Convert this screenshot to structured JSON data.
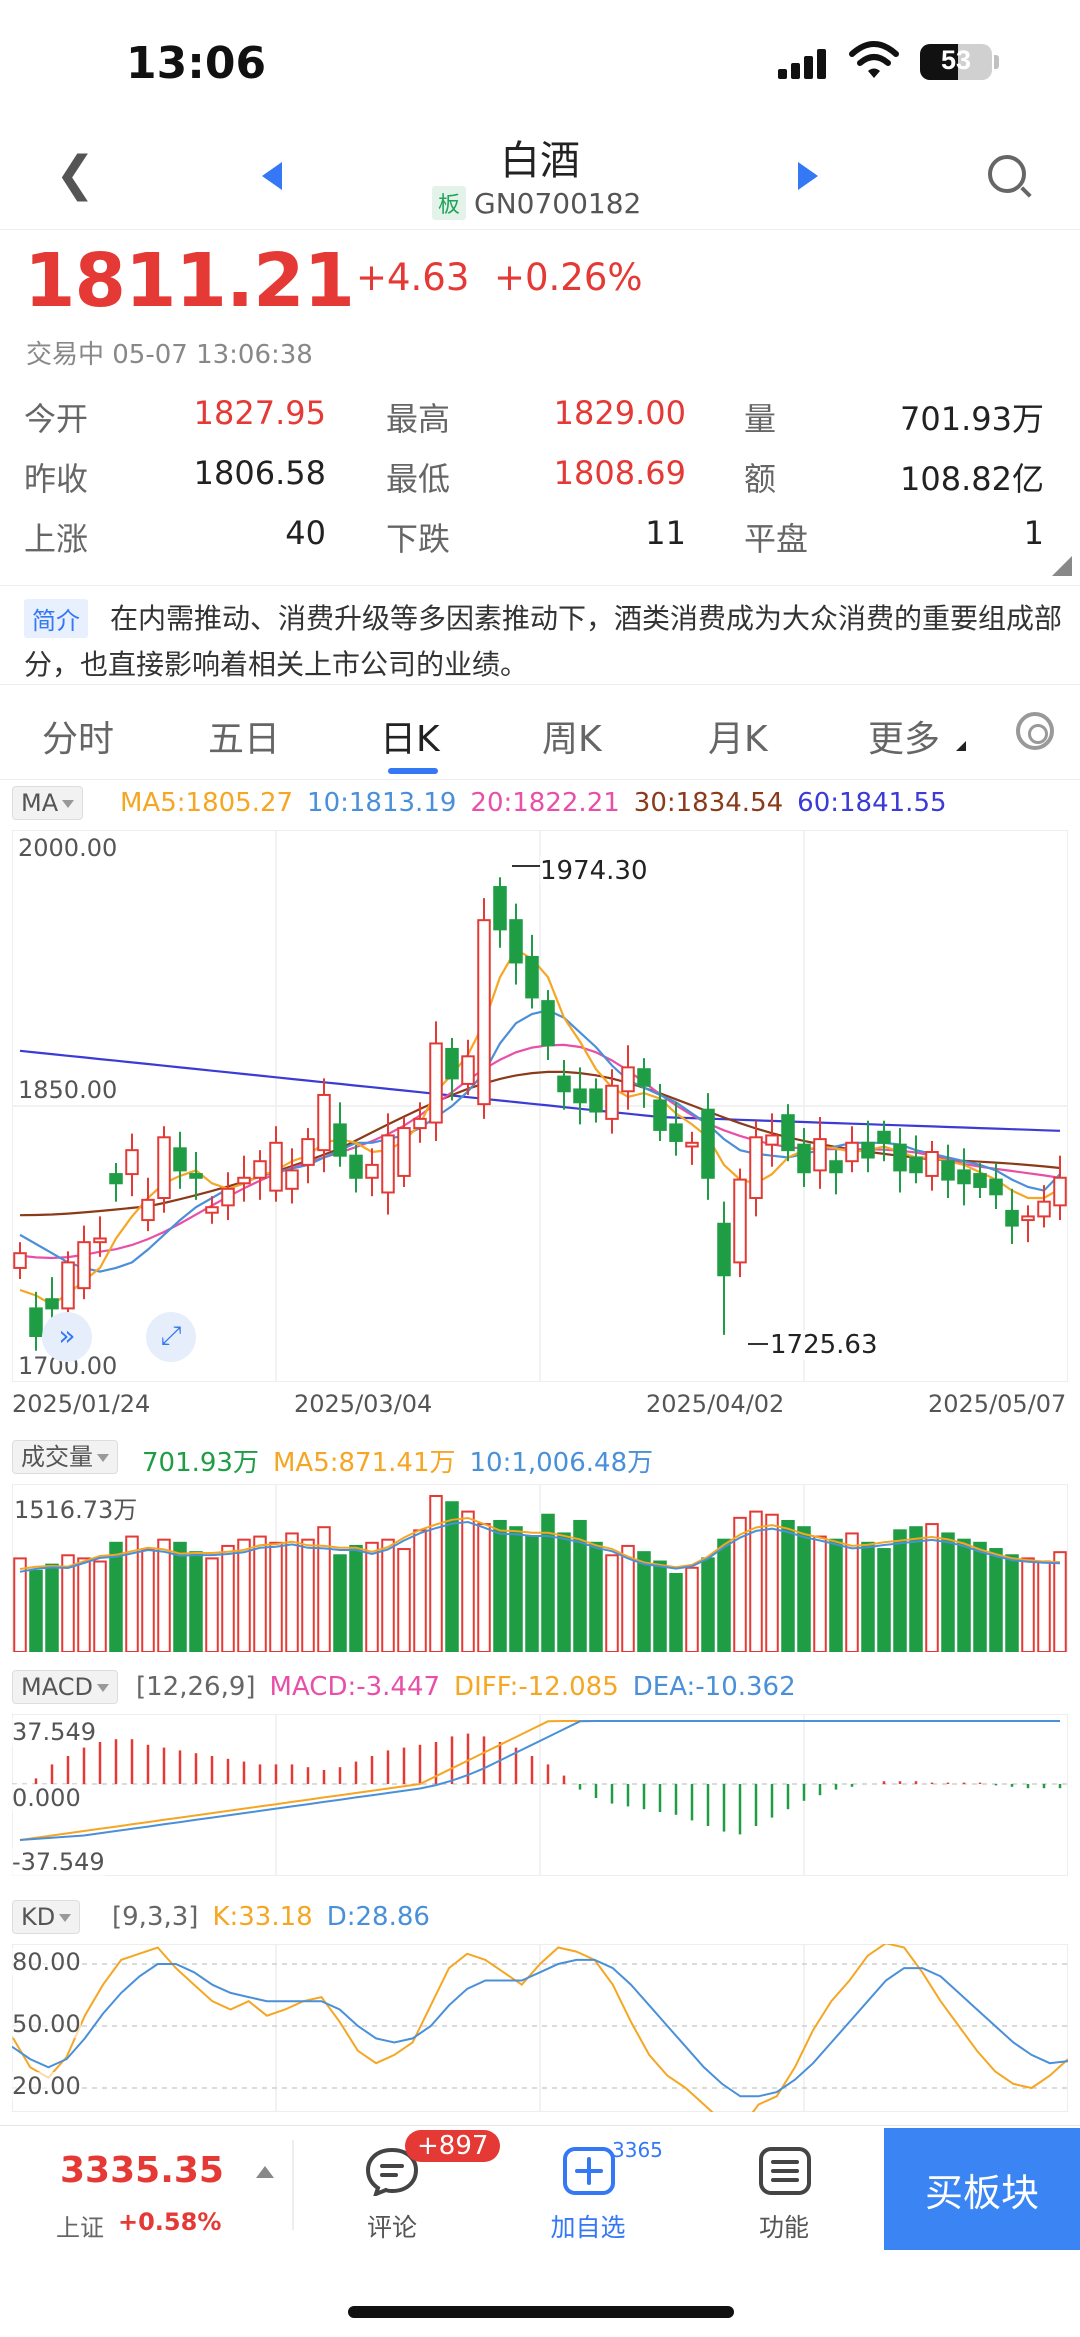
{
  "status_bar": {
    "time": "13:06",
    "battery": "53",
    "battery_fraction": 0.53
  },
  "nav": {
    "title": "白酒",
    "badge": "板",
    "code": "GN0700182"
  },
  "quote": {
    "price": "1811.21",
    "change": "+4.63",
    "change_pct": "+0.26%",
    "status": "交易中 05-07 13:06:38",
    "stats": [
      {
        "label": "今开",
        "value": "1827.95",
        "color": "red"
      },
      {
        "label": "最高",
        "value": "1829.00",
        "color": "red"
      },
      {
        "label": "量",
        "value": "701.93万",
        "color": "dark"
      },
      {
        "label": "昨收",
        "value": "1806.58",
        "color": "dark"
      },
      {
        "label": "最低",
        "value": "1808.69",
        "color": "red"
      },
      {
        "label": "额",
        "value": "108.82亿",
        "color": "dark"
      },
      {
        "label": "上涨",
        "value": "40",
        "color": "dark"
      },
      {
        "label": "下跌",
        "value": "11",
        "color": "dark"
      },
      {
        "label": "平盘",
        "value": "1",
        "color": "dark"
      }
    ]
  },
  "intro": {
    "tag": "简介",
    "text": "在内需推动、消费升级等多因素推动下，酒类消费成为大众消费的重要组成部分，也直接影响着相关上市公司的业绩。"
  },
  "tabs": [
    "分时",
    "五日",
    "日K",
    "周K",
    "月K",
    "更多"
  ],
  "active_tab": "日K",
  "colors": {
    "up": "#e53935",
    "down": "#1f9d45",
    "ma5": "#f5a623",
    "ma10": "#4a90d9",
    "ma20": "#e84fa8",
    "ma30": "#8b3a1a",
    "ma60": "#3b3bd6",
    "accent": "#3478f6"
  },
  "ma_bar": {
    "label": "MA",
    "ma5": "MA5:1805.27",
    "ma10": "10:1813.19",
    "ma20": "20:1822.21",
    "ma30": "30:1834.54",
    "ma60": "60:1841.55"
  },
  "kline_axis": {
    "top": "2000.00",
    "mid": "1850.00",
    "bottom": "1700.00",
    "high_label": "1974.30",
    "low_label": "1725.63"
  },
  "dates": [
    "2025/01/24",
    "2025/03/04",
    "2025/04/02",
    "2025/05/07"
  ],
  "volume_bar": {
    "label": "成交量",
    "vol": "701.93万",
    "ma5": "MA5:871.41万",
    "ma10": "10:1,006.48万",
    "axis_top": "1516.73万"
  },
  "macd_bar": {
    "label": "MACD",
    "params": "[12,26,9]",
    "macd": "MACD:-3.447",
    "diff": "DIFF:-12.085",
    "dea": "DEA:-10.362",
    "axis_top": "37.549",
    "axis_mid": "0.000",
    "axis_bottom": "-37.549"
  },
  "kd_bar": {
    "label": "KD",
    "params": "[9,3,3]",
    "k": "K:33.18",
    "d": "D:28.86",
    "axis_top": "80.00",
    "axis_mid": "50.00",
    "axis_bottom": "20.00"
  },
  "bottom": {
    "index_price": "3335.35",
    "index_name": "上证",
    "index_pct": "+0.58%",
    "comment_badge": "+897",
    "comment_label": "评论",
    "fav_count": "3365",
    "fav_label": "加自选",
    "func_label": "功能",
    "buy_label": "买板块"
  },
  "chart_data": {
    "type": "candlestick",
    "x_range": [
      "2025/01/24",
      "2025/05/07"
    ],
    "ylim": [
      1700,
      2000
    ],
    "candles": [
      {
        "o": 1762,
        "c": 1770
      },
      {
        "o": 1740,
        "c": 1725
      },
      {
        "o": 1745,
        "c": 1740
      },
      {
        "o": 1740,
        "c": 1765
      },
      {
        "o": 1751,
        "c": 1776
      },
      {
        "o": 1776,
        "c": 1778
      },
      {
        "o": 1813,
        "c": 1808
      },
      {
        "o": 1813,
        "c": 1826
      },
      {
        "o": 1788,
        "c": 1799
      },
      {
        "o": 1800,
        "c": 1833
      },
      {
        "o": 1827,
        "c": 1815
      },
      {
        "o": 1813,
        "c": 1811
      },
      {
        "o": 1792,
        "c": 1795
      },
      {
        "o": 1796,
        "c": 1805
      },
      {
        "o": 1808,
        "c": 1811
      },
      {
        "o": 1811,
        "c": 1820
      },
      {
        "o": 1804,
        "c": 1830
      },
      {
        "o": 1805,
        "c": 1815
      },
      {
        "o": 1818,
        "c": 1832
      },
      {
        "o": 1826,
        "c": 1856
      },
      {
        "o": 1840,
        "c": 1823
      },
      {
        "o": 1823,
        "c": 1811
      },
      {
        "o": 1811,
        "c": 1818
      },
      {
        "o": 1803,
        "c": 1834
      },
      {
        "o": 1812,
        "c": 1838
      },
      {
        "o": 1838,
        "c": 1843
      },
      {
        "o": 1841,
        "c": 1884
      },
      {
        "o": 1881,
        "c": 1865
      },
      {
        "o": 1862,
        "c": 1877
      },
      {
        "o": 1851,
        "c": 1951
      },
      {
        "o": 1969,
        "c": 1946
      },
      {
        "o": 1951,
        "c": 1928
      },
      {
        "o": 1931,
        "c": 1909
      },
      {
        "o": 1907,
        "c": 1883
      },
      {
        "o": 1866,
        "c": 1858
      },
      {
        "o": 1859,
        "c": 1852
      },
      {
        "o": 1859,
        "c": 1847
      },
      {
        "o": 1843,
        "c": 1861
      },
      {
        "o": 1858,
        "c": 1871
      },
      {
        "o": 1870,
        "c": 1861
      },
      {
        "o": 1853,
        "c": 1837
      },
      {
        "o": 1840,
        "c": 1831
      },
      {
        "o": 1828,
        "c": 1830
      },
      {
        "o": 1848,
        "c": 1811
      },
      {
        "o": 1786,
        "c": 1758
      },
      {
        "o": 1765,
        "c": 1810
      },
      {
        "o": 1800,
        "c": 1833
      },
      {
        "o": 1829,
        "c": 1834
      },
      {
        "o": 1845,
        "c": 1826
      },
      {
        "o": 1829,
        "c": 1814
      },
      {
        "o": 1815,
        "c": 1832
      },
      {
        "o": 1820,
        "c": 1814
      },
      {
        "o": 1820,
        "c": 1830
      },
      {
        "o": 1830,
        "c": 1822
      },
      {
        "o": 1836,
        "c": 1830
      },
      {
        "o": 1829,
        "c": 1815
      },
      {
        "o": 1822,
        "c": 1814
      },
      {
        "o": 1812,
        "c": 1825
      },
      {
        "o": 1820,
        "c": 1810
      },
      {
        "o": 1815,
        "c": 1808
      },
      {
        "o": 1813,
        "c": 1806
      },
      {
        "o": 1810,
        "c": 1802
      },
      {
        "o": 1793,
        "c": 1785
      },
      {
        "o": 1788,
        "c": 1790
      },
      {
        "o": 1790,
        "c": 1798
      },
      {
        "o": 1796,
        "c": 1811
      }
    ],
    "ma5": [
      1750,
      1747,
      1742,
      1748,
      1755,
      1762,
      1778,
      1790,
      1800,
      1808,
      1812,
      1815,
      1808,
      1805,
      1808,
      1812,
      1815,
      1820,
      1823,
      1830,
      1832,
      1830,
      1825,
      1826,
      1831,
      1840,
      1858,
      1867,
      1878,
      1895,
      1920,
      1935,
      1930,
      1920,
      1898,
      1885,
      1870,
      1860,
      1855,
      1857,
      1854,
      1846,
      1840,
      1833,
      1818,
      1810,
      1808,
      1813,
      1822,
      1826,
      1828,
      1827,
      1825,
      1826,
      1828,
      1825,
      1822,
      1822,
      1820,
      1818,
      1814,
      1810,
      1804,
      1800,
      1800,
      1805
    ],
    "ma10": [
      1780,
      1775,
      1770,
      1765,
      1762,
      1760,
      1762,
      1765,
      1772,
      1780,
      1788,
      1795,
      1800,
      1805,
      1808,
      1812,
      1814,
      1816,
      1818,
      1822,
      1826,
      1830,
      1830,
      1832,
      1834,
      1838,
      1844,
      1850,
      1858,
      1868,
      1884,
      1895,
      1900,
      1902,
      1898,
      1890,
      1882,
      1872,
      1864,
      1860,
      1856,
      1852,
      1846,
      1840,
      1832,
      1826,
      1824,
      1823,
      1822,
      1824,
      1826,
      1828,
      1830,
      1830,
      1830,
      1829,
      1826,
      1824,
      1822,
      1820,
      1818,
      1815,
      1810,
      1806,
      1804,
      1813
    ]
  }
}
